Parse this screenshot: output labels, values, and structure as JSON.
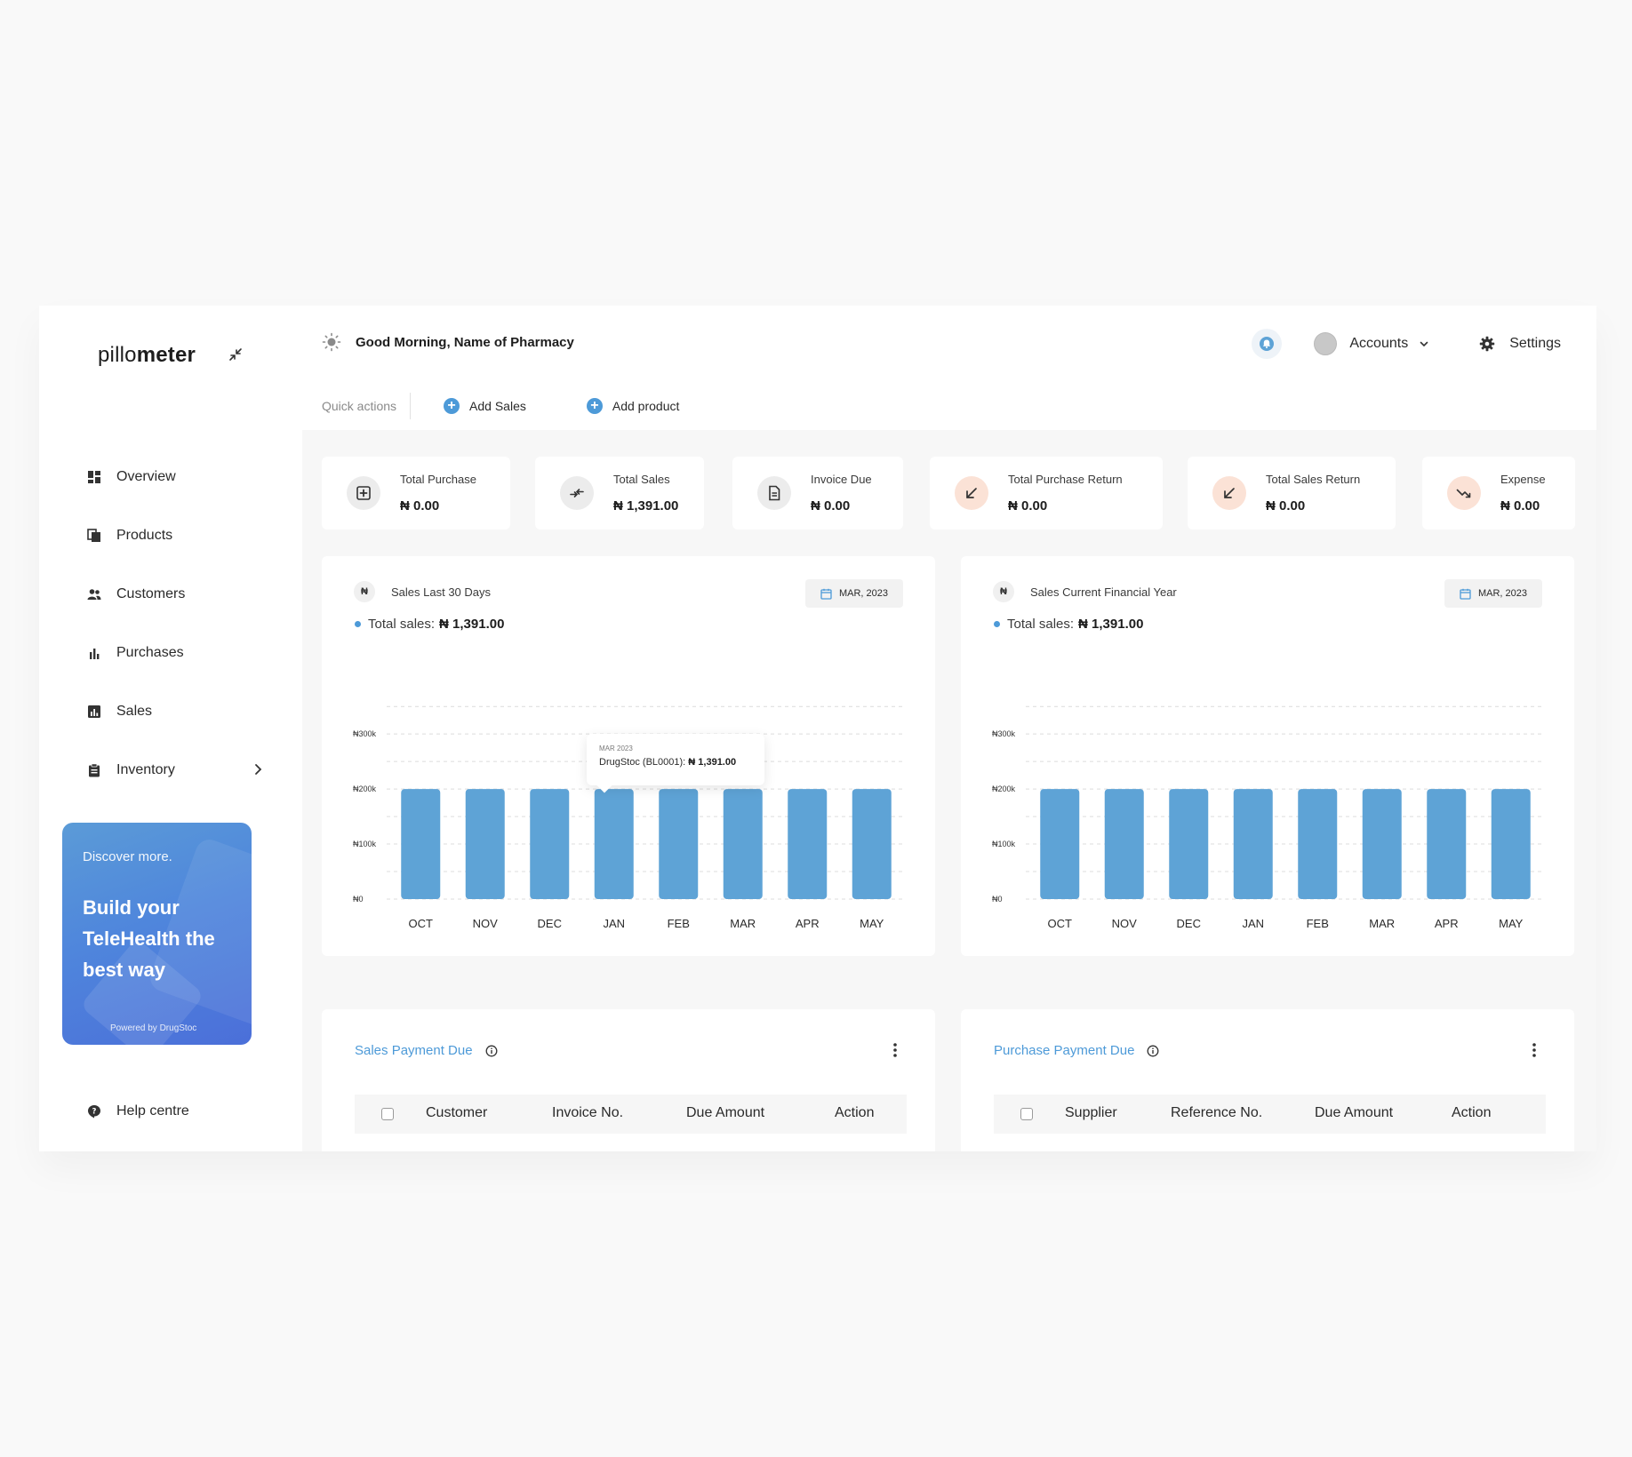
{
  "app": {
    "logo_light": "pillo",
    "logo_bold": "meter"
  },
  "sidebar": {
    "items": [
      {
        "label": "Overview",
        "icon": "dashboard-icon"
      },
      {
        "label": "Products",
        "icon": "products-icon"
      },
      {
        "label": "Customers",
        "icon": "customers-icon"
      },
      {
        "label": "Purchases",
        "icon": "bar-chart-icon"
      },
      {
        "label": "Sales",
        "icon": "sales-icon"
      },
      {
        "label": "Inventory",
        "icon": "clipboard-icon"
      }
    ],
    "help_label": "Help centre"
  },
  "promo": {
    "small": "Discover more.",
    "headline": "Build your TeleHealth the best way",
    "powered": "Powered by DrugStoc"
  },
  "header": {
    "greeting": "Good Morning, Name of Pharmacy",
    "accounts_label": "Accounts",
    "settings_label": "Settings",
    "quick_actions_label": "Quick actions",
    "add_sales_label": "Add Sales",
    "add_product_label": "Add product"
  },
  "stats": [
    {
      "label": "Total Purchase",
      "value": "₦ 0.00"
    },
    {
      "label": "Total Sales",
      "value": "₦ 1,391.00"
    },
    {
      "label": "Invoice Due",
      "value": "₦ 0.00"
    },
    {
      "label": "Total Purchase Return",
      "value": "₦ 0.00"
    },
    {
      "label": "Total Sales Return",
      "value": "₦ 0.00"
    },
    {
      "label": "Expense",
      "value": "₦ 0.00"
    }
  ],
  "colors": {
    "accent": "#4d9ad8",
    "bar": "#5ea3d6",
    "peach": "#fbe2d6"
  },
  "charts": {
    "naira_symbol": "₦",
    "left": {
      "title": "Sales Last 30 Days",
      "date_label": "MAR, 2023",
      "total_label": "Total sales:",
      "total_value": "₦ 1,391.00"
    },
    "right": {
      "title": "Sales Current Financial Year",
      "date_label": "MAR, 2023",
      "total_label": "Total sales:",
      "total_value": "₦ 1,391.00"
    },
    "tooltip": {
      "date": "MAR 2023",
      "label": "DrugStoc (BL0001):",
      "value": "₦ 1,391.00"
    }
  },
  "chart_data": [
    {
      "type": "bar",
      "title": "Sales Last 30 Days",
      "categories": [
        "OCT",
        "NOV",
        "DEC",
        "JAN",
        "FEB",
        "MAR",
        "APR",
        "MAY"
      ],
      "values": [
        200000,
        200000,
        200000,
        200000,
        200000,
        200000,
        200000,
        200000
      ],
      "yticks": [
        "₦0",
        "₦100k",
        "₦200k",
        "₦300k"
      ],
      "ylim": [
        0,
        360000
      ],
      "grid": true,
      "xlabel": "",
      "ylabel": ""
    },
    {
      "type": "bar",
      "title": "Sales Current Financial Year",
      "categories": [
        "OCT",
        "NOV",
        "DEC",
        "JAN",
        "FEB",
        "MAR",
        "APR",
        "MAY"
      ],
      "values": [
        200000,
        200000,
        200000,
        200000,
        200000,
        200000,
        200000,
        200000
      ],
      "yticks": [
        "₦0",
        "₦100k",
        "₦200k",
        "₦300k"
      ],
      "ylim": [
        0,
        360000
      ],
      "grid": true,
      "xlabel": "",
      "ylabel": ""
    }
  ],
  "tables": {
    "sales": {
      "title": "Sales Payment Due",
      "columns": [
        "Customer",
        "Invoice No.",
        "Due Amount",
        "Action"
      ]
    },
    "purchase": {
      "title": "Purchase Payment Due",
      "columns": [
        "Supplier",
        "Reference No.",
        "Due Amount",
        "Action"
      ]
    }
  }
}
